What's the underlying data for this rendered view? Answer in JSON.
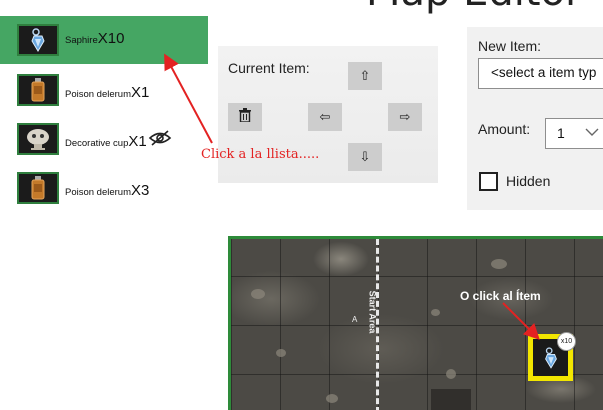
{
  "title": "Map Editor",
  "inventory": [
    {
      "name": "Saphire",
      "qty": "X10",
      "selected": true,
      "icon": "gem-icon"
    },
    {
      "name": "Poison delerum",
      "qty": "X1",
      "selected": false,
      "icon": "flask-icon"
    },
    {
      "name": "Decorative cup",
      "qty": "X1",
      "selected": false,
      "icon": "cup-icon",
      "hidden_icon": "eye-off-icon"
    },
    {
      "name": "Poison delerum",
      "qty": "X3",
      "selected": false,
      "icon": "flask-icon"
    }
  ],
  "current_item": {
    "label": "Current Item:",
    "buttons": {
      "up": "⇧",
      "down": "⇩",
      "left": "⇦",
      "right": "⇨",
      "delete": "trash-icon"
    }
  },
  "new_item": {
    "label": "New Item:",
    "select_value": "<select a item typ",
    "amount_label": "Amount:",
    "amount_value": "1",
    "hidden_label": "Hidden",
    "hidden_checked": false
  },
  "annotations": {
    "list_hint": "Click a  la llista.....",
    "item_hint": "O click al Ítem"
  },
  "map": {
    "start_label": "Start Area",
    "start_sub": "A",
    "token_badge": "x10"
  },
  "colors": {
    "selected_bg": "#45a663",
    "annotation_red": "#e32222",
    "token_highlight": "#f2e600",
    "map_border": "#2e8b3a"
  }
}
